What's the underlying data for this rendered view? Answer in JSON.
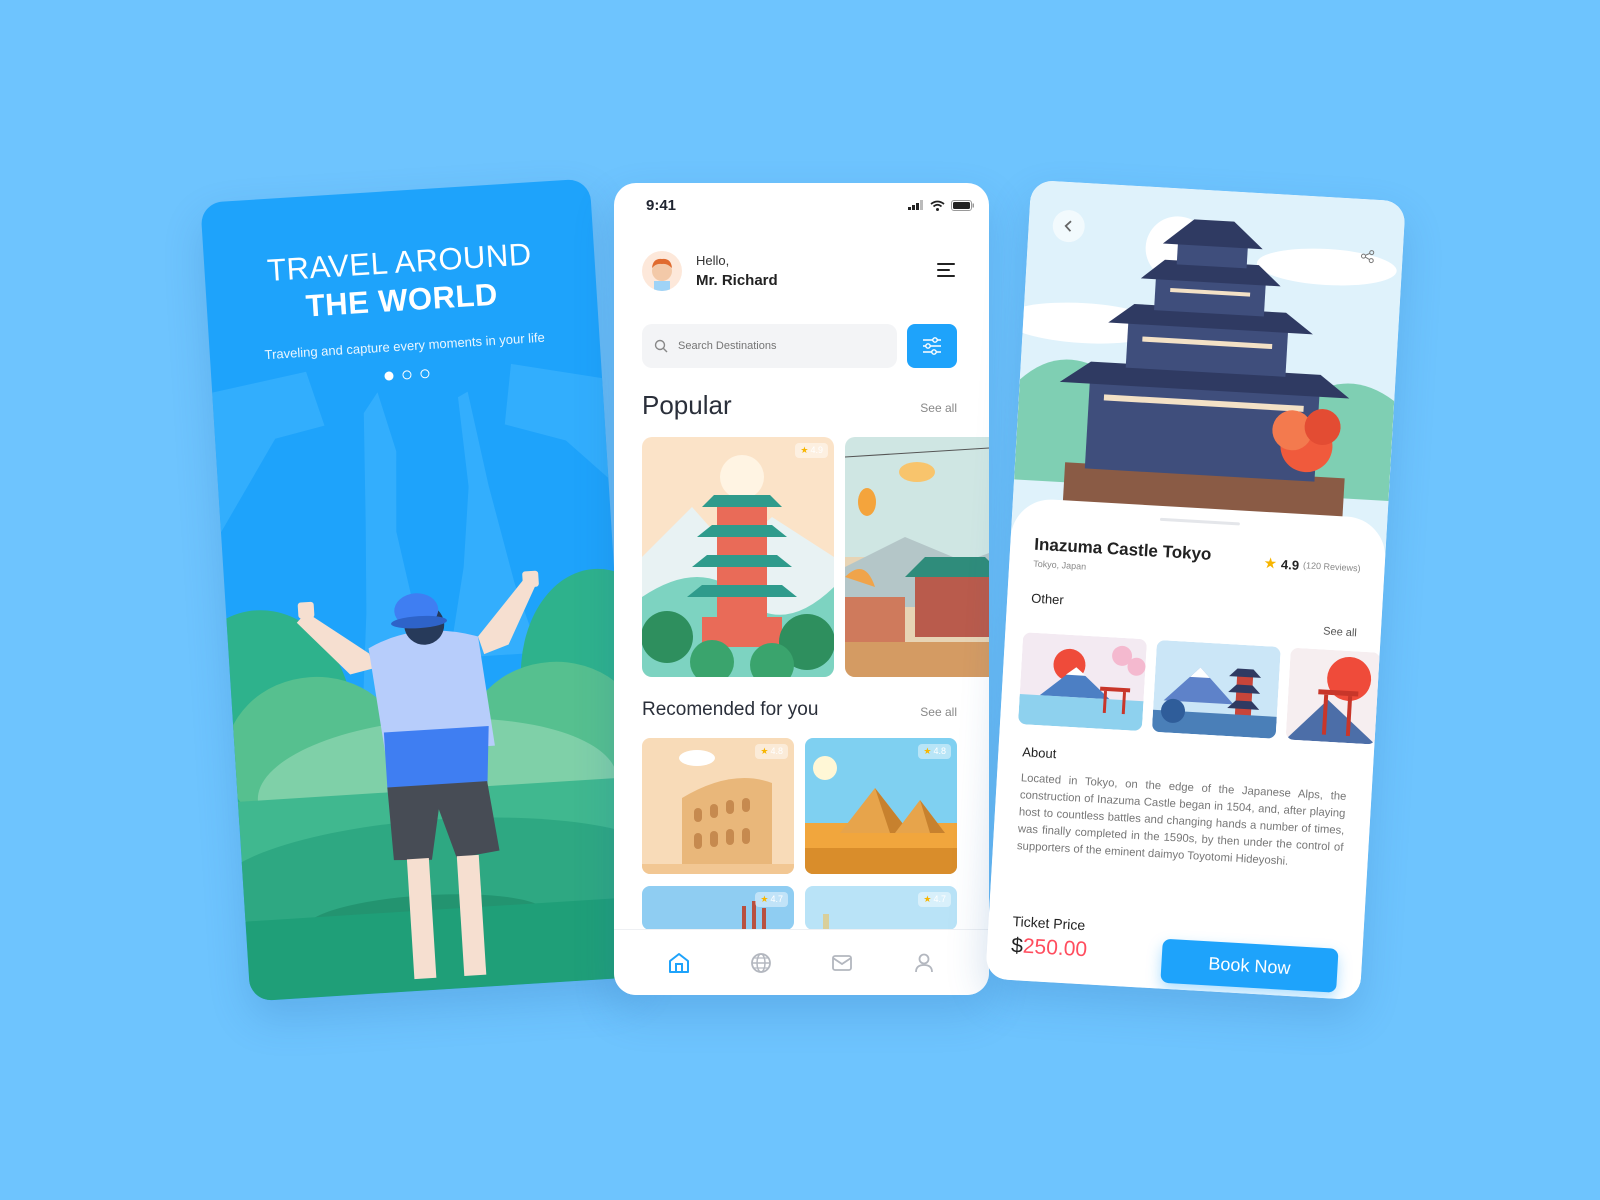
{
  "onboarding": {
    "title_line1": "TRAVEL AROUND",
    "title_line2": "THE WORLD",
    "subtitle": "Traveling and capture every moments in your life",
    "page_dots": 3,
    "active_dot": 1
  },
  "home": {
    "status": {
      "time": "9:41"
    },
    "greeting": {
      "hello": "Hello,",
      "name": "Mr. Richard"
    },
    "search": {
      "placeholder": "Search Destinations"
    },
    "popular": {
      "title": "Popular",
      "see_all": "See all",
      "cards": [
        {
          "rating": "4.9"
        }
      ]
    },
    "recommended": {
      "title": "Recomended for you",
      "see_all": "See all",
      "cards": [
        {
          "rating": "4.8"
        },
        {
          "rating": "4.8"
        },
        {
          "rating": "4.7"
        },
        {
          "rating": "4.7"
        }
      ]
    },
    "nav": [
      "home-icon",
      "globe-icon",
      "mail-icon",
      "profile-icon"
    ],
    "active_nav": "home-icon"
  },
  "detail": {
    "place_name": "Inazuma Castle Tokyo",
    "location": "Tokyo, Japan",
    "rating": "4.9",
    "reviews": "(120 Reviews)",
    "other_title": "Other",
    "other_see_all": "See all",
    "about_title": "About",
    "about_text": "Located in Tokyo, on the edge of the Japanese Alps, the construction of Inazuma Castle began in 1504, and, after playing host to countless battles and changing hands a number of times, was finally completed in the 1590s, by then under the control of supporters of the eminent daimyo Toyotomi Hideyoshi.",
    "ticket_label": "Ticket Price",
    "currency": "$",
    "price": "250.00",
    "book_label": "Book Now"
  },
  "colors": {
    "primary": "#1ea3fb",
    "background": "#6ec4fe",
    "price": "#ff4d5e",
    "star": "#f7b500"
  }
}
